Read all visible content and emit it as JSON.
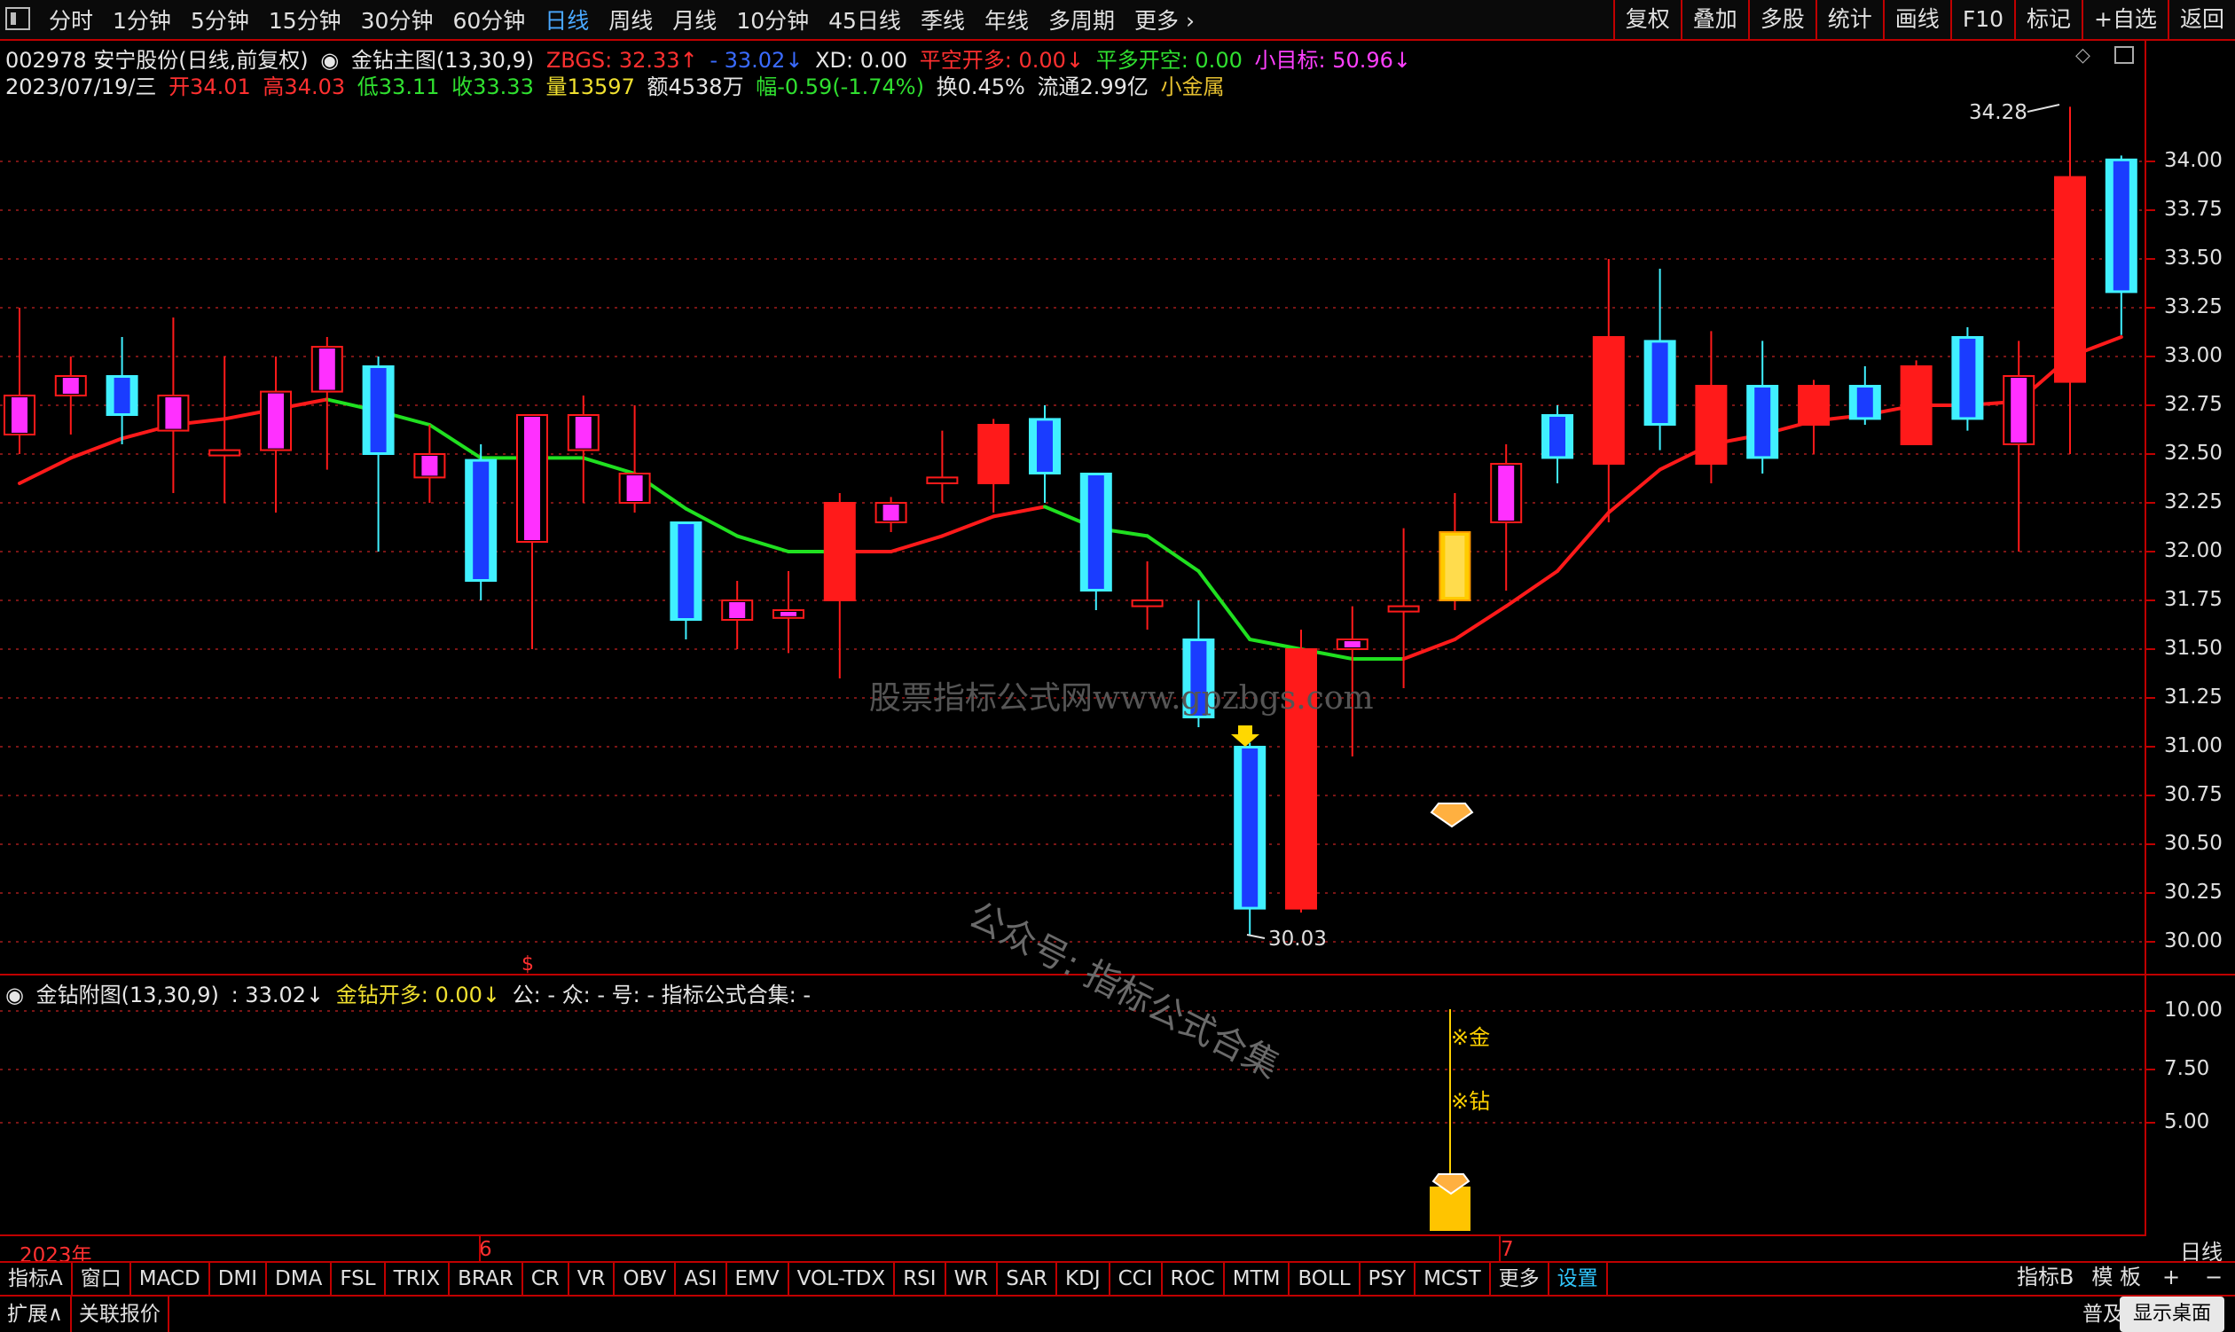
{
  "toolbar": {
    "periods": [
      "分时",
      "1分钟",
      "5分钟",
      "15分钟",
      "30分钟",
      "60分钟",
      "日线",
      "周线",
      "月线",
      "10分钟",
      "45日线",
      "季线",
      "年线",
      "多周期",
      "更多"
    ],
    "active_period": "日线",
    "right_tools": [
      "复权",
      "叠加",
      "多股",
      "统计",
      "画线",
      "F10",
      "标记",
      "+自选",
      "返回"
    ]
  },
  "info_line1": {
    "stock": "002978 安宁股份(日线,前复权)",
    "indicator": "金钻主图(13,30,9)",
    "zbgs": "ZBGS: 32.33↑",
    "blue_val": "- 33.02↓",
    "xd": "XD: 0.00",
    "kong": "平空开多: 0.00↓",
    "duo": "平多开空: 0.00",
    "target": "小目标: 50.96↓"
  },
  "info_line2": {
    "date": "2023/07/19/三",
    "open": "开34.01",
    "high": "高34.03",
    "low": "低33.11",
    "close": "收33.33",
    "volume": "量13597",
    "amount": "额4538万",
    "change": "幅-0.59(-1.74%)",
    "turnover": "换0.45%",
    "float": "流通2.99亿",
    "sector": "小金属"
  },
  "main_axis": {
    "labels": [
      "34.00",
      "33.75",
      "33.50",
      "33.25",
      "33.00",
      "32.75",
      "32.50",
      "32.25",
      "32.00",
      "31.75",
      "31.50",
      "31.25",
      "31.00",
      "30.75",
      "30.50",
      "30.25",
      "30.00"
    ],
    "min": 30.0,
    "max": 34.0
  },
  "high_mark": "34.28",
  "low_mark": "30.03",
  "sub_info": {
    "name": "金钻附图(13,30,9)",
    "value": ": 33.02↓",
    "signal": "金钻开多: 0.00↓",
    "rest": "公: -  众: -  号: -  指标公式合集: -"
  },
  "sub_axis": {
    "labels": [
      "10.00",
      "7.50",
      "5.00"
    ]
  },
  "sub_signals": {
    "gold": "※金",
    "diamond": "※钻"
  },
  "dates": {
    "year": "2023年",
    "m6": "6",
    "m7": "7"
  },
  "watermark1": "股票指标公式网www.gpzbgs.com",
  "watermark2": "公众号: 指标公式合集",
  "indicators": [
    "指标A",
    "窗口",
    "MACD",
    "DMI",
    "DMA",
    "FSL",
    "TRIX",
    "BRAR",
    "CR",
    "VR",
    "OBV",
    "ASI",
    "EMV",
    "VOL-TDX",
    "RSI",
    "WR",
    "SAR",
    "KDJ",
    "CCI",
    "ROC",
    "MTM",
    "BOLL",
    "PSY",
    "MCST",
    "更多",
    "设置"
  ],
  "active_indicator": "设置",
  "indicator_b": "指标B",
  "template": "模 板",
  "status": [
    "扩展∧",
    "关联报价"
  ],
  "puqi": "普及",
  "rixian": "日线",
  "desktop": "显示桌面",
  "chart_data": {
    "type": "candlestick",
    "y_range": [
      30.0,
      34.0
    ],
    "candles": [
      {
        "o": 32.8,
        "c": 32.6,
        "h": 33.25,
        "l": 32.5,
        "k": "m"
      },
      {
        "o": 32.9,
        "c": 32.8,
        "h": 33.0,
        "l": 32.6,
        "k": "m"
      },
      {
        "o": 32.7,
        "c": 32.9,
        "h": 33.1,
        "l": 32.55,
        "k": "c"
      },
      {
        "o": 32.8,
        "c": 32.62,
        "h": 33.2,
        "l": 32.3,
        "k": "m"
      },
      {
        "o": 32.52,
        "c": 32.52,
        "h": 33.0,
        "l": 32.25,
        "k": "m"
      },
      {
        "o": 32.82,
        "c": 32.52,
        "h": 33.0,
        "l": 32.2,
        "k": "m"
      },
      {
        "o": 33.05,
        "c": 32.82,
        "h": 33.1,
        "l": 32.42,
        "k": "m"
      },
      {
        "o": 32.5,
        "c": 32.95,
        "h": 33.0,
        "l": 32.0,
        "k": "c"
      },
      {
        "o": 32.5,
        "c": 32.38,
        "h": 32.65,
        "l": 32.25,
        "k": "m"
      },
      {
        "o": 31.85,
        "c": 32.47,
        "h": 32.55,
        "l": 31.75,
        "k": "b"
      },
      {
        "o": 32.7,
        "c": 32.05,
        "h": 32.7,
        "l": 31.5,
        "k": "m"
      },
      {
        "o": 32.7,
        "c": 32.52,
        "h": 32.8,
        "l": 32.25,
        "k": "m"
      },
      {
        "o": 32.4,
        "c": 32.25,
        "h": 32.75,
        "l": 32.2,
        "k": "m"
      },
      {
        "o": 31.65,
        "c": 32.15,
        "h": 32.15,
        "l": 31.55,
        "k": "b"
      },
      {
        "o": 31.65,
        "c": 31.75,
        "h": 31.85,
        "l": 31.5,
        "k": "m"
      },
      {
        "o": 31.7,
        "c": 31.66,
        "h": 31.9,
        "l": 31.48,
        "k": "m"
      },
      {
        "o": 32.25,
        "c": 31.75,
        "h": 32.3,
        "l": 31.35,
        "k": "r"
      },
      {
        "o": 32.25,
        "c": 32.15,
        "h": 32.28,
        "l": 32.1,
        "k": "m"
      },
      {
        "o": 32.35,
        "c": 32.38,
        "h": 32.62,
        "l": 32.25,
        "k": "m"
      },
      {
        "o": 32.35,
        "c": 32.65,
        "h": 32.68,
        "l": 32.2,
        "k": "r"
      },
      {
        "o": 32.4,
        "c": 32.68,
        "h": 32.75,
        "l": 32.25,
        "k": "b"
      },
      {
        "o": 31.8,
        "c": 32.4,
        "h": 32.4,
        "l": 31.7,
        "k": "b"
      },
      {
        "o": 31.75,
        "c": 31.72,
        "h": 31.95,
        "l": 31.6,
        "k": "m"
      },
      {
        "o": 31.15,
        "c": 31.55,
        "h": 31.75,
        "l": 31.1,
        "k": "b"
      },
      {
        "o": 30.17,
        "c": 31.0,
        "h": 31.02,
        "l": 30.03,
        "k": "b"
      },
      {
        "o": 30.17,
        "c": 31.5,
        "h": 31.6,
        "l": 30.15,
        "k": "r"
      },
      {
        "o": 31.5,
        "c": 31.55,
        "h": 31.72,
        "l": 30.95,
        "k": "m"
      },
      {
        "o": 31.7,
        "c": 31.72,
        "h": 32.12,
        "l": 31.3,
        "k": "m"
      },
      {
        "o": 31.75,
        "c": 32.1,
        "h": 32.3,
        "l": 31.7,
        "k": "y"
      },
      {
        "o": 32.15,
        "c": 32.45,
        "h": 32.55,
        "l": 31.8,
        "k": "m"
      },
      {
        "o": 32.48,
        "c": 32.7,
        "h": 32.75,
        "l": 32.35,
        "k": "b"
      },
      {
        "o": 33.1,
        "c": 32.45,
        "h": 33.5,
        "l": 32.15,
        "k": "r"
      },
      {
        "o": 32.65,
        "c": 33.08,
        "h": 33.45,
        "l": 32.52,
        "k": "b"
      },
      {
        "o": 32.85,
        "c": 32.45,
        "h": 33.13,
        "l": 32.35,
        "k": "r"
      },
      {
        "o": 32.48,
        "c": 32.85,
        "h": 33.08,
        "l": 32.4,
        "k": "b"
      },
      {
        "o": 32.65,
        "c": 32.85,
        "h": 32.88,
        "l": 32.5,
        "k": "r"
      },
      {
        "o": 32.68,
        "c": 32.85,
        "h": 32.95,
        "l": 32.65,
        "k": "b"
      },
      {
        "o": 32.55,
        "c": 32.95,
        "h": 32.98,
        "l": 32.55,
        "k": "r"
      },
      {
        "o": 32.68,
        "c": 33.1,
        "h": 33.15,
        "l": 32.62,
        "k": "b"
      },
      {
        "o": 32.9,
        "c": 32.55,
        "h": 33.08,
        "l": 32.0,
        "k": "m"
      },
      {
        "o": 32.87,
        "c": 33.92,
        "h": 34.28,
        "l": 32.5,
        "k": "r"
      },
      {
        "o": 33.33,
        "c": 34.01,
        "h": 34.03,
        "l": 33.11,
        "k": "b"
      }
    ],
    "ma_line": [
      {
        "i": 0,
        "v": 32.35,
        "col": "red"
      },
      {
        "i": 1,
        "v": 32.48,
        "col": "red"
      },
      {
        "i": 2,
        "v": 32.58,
        "col": "red"
      },
      {
        "i": 3,
        "v": 32.65,
        "col": "red"
      },
      {
        "i": 4,
        "v": 32.68,
        "col": "red"
      },
      {
        "i": 5,
        "v": 32.73,
        "col": "red"
      },
      {
        "i": 6,
        "v": 32.78,
        "col": "red"
      },
      {
        "i": 7,
        "v": 32.72,
        "col": "green"
      },
      {
        "i": 8,
        "v": 32.65,
        "col": "green"
      },
      {
        "i": 9,
        "v": 32.48,
        "col": "green"
      },
      {
        "i": 10,
        "v": 32.48,
        "col": "green"
      },
      {
        "i": 11,
        "v": 32.48,
        "col": "green"
      },
      {
        "i": 12,
        "v": 32.4,
        "col": "green"
      },
      {
        "i": 13,
        "v": 32.22,
        "col": "green"
      },
      {
        "i": 14,
        "v": 32.08,
        "col": "green"
      },
      {
        "i": 15,
        "v": 32.0,
        "col": "green"
      },
      {
        "i": 16,
        "v": 32.0,
        "col": "green"
      },
      {
        "i": 17,
        "v": 32.0,
        "col": "red"
      },
      {
        "i": 18,
        "v": 32.08,
        "col": "red"
      },
      {
        "i": 19,
        "v": 32.18,
        "col": "red"
      },
      {
        "i": 20,
        "v": 32.23,
        "col": "red"
      },
      {
        "i": 21,
        "v": 32.12,
        "col": "green"
      },
      {
        "i": 22,
        "v": 32.08,
        "col": "green"
      },
      {
        "i": 23,
        "v": 31.9,
        "col": "green"
      },
      {
        "i": 24,
        "v": 31.55,
        "col": "green"
      },
      {
        "i": 25,
        "v": 31.5,
        "col": "green"
      },
      {
        "i": 26,
        "v": 31.45,
        "col": "green"
      },
      {
        "i": 27,
        "v": 31.45,
        "col": "green"
      },
      {
        "i": 28,
        "v": 31.55,
        "col": "red"
      },
      {
        "i": 29,
        "v": 31.72,
        "col": "red"
      },
      {
        "i": 30,
        "v": 31.9,
        "col": "red"
      },
      {
        "i": 31,
        "v": 32.2,
        "col": "red"
      },
      {
        "i": 32,
        "v": 32.42,
        "col": "red"
      },
      {
        "i": 33,
        "v": 32.55,
        "col": "red"
      },
      {
        "i": 34,
        "v": 32.6,
        "col": "red"
      },
      {
        "i": 35,
        "v": 32.67,
        "col": "red"
      },
      {
        "i": 36,
        "v": 32.7,
        "col": "red"
      },
      {
        "i": 37,
        "v": 32.75,
        "col": "red"
      },
      {
        "i": 38,
        "v": 32.75,
        "col": "red"
      },
      {
        "i": 39,
        "v": 32.77,
        "col": "red"
      },
      {
        "i": 40,
        "v": 33.0,
        "col": "red"
      },
      {
        "i": 41,
        "v": 33.1,
        "col": "red"
      }
    ]
  },
  "colors": {
    "red": "#ff1a1a",
    "magenta": "#ff30ff",
    "cyan": "#40f0ff",
    "blue": "#1a3cff",
    "gold": "#ffcc00",
    "green": "#20e020"
  }
}
